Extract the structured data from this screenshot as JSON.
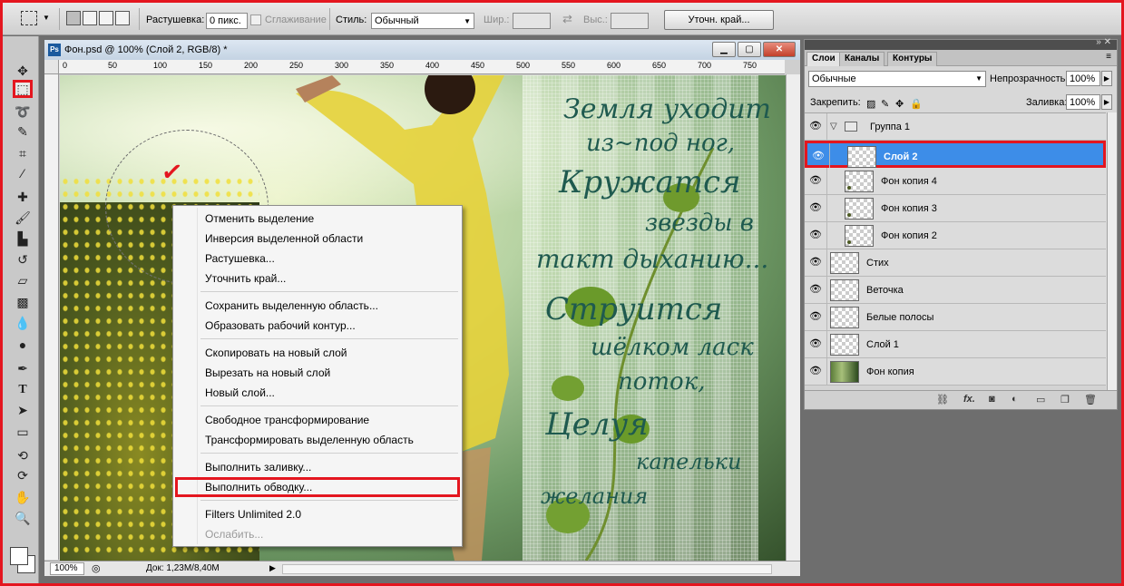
{
  "options_bar": {
    "feather_label": "Растушевка:",
    "feather_value": "0 пикс.",
    "antialias_label": "Сглаживание",
    "style_label": "Стиль:",
    "style_value": "Обычный",
    "width_label": "Шир.:",
    "height_label": "Выс.:",
    "refine_edge_button": "Уточн. край..."
  },
  "document": {
    "title": "Фон.psd @ 100% (Слой 2, RGB/8) *",
    "ruler_ticks": [
      "0",
      "50",
      "100",
      "150",
      "200",
      "250",
      "300",
      "350",
      "400",
      "450",
      "500",
      "550",
      "600",
      "650",
      "700",
      "750"
    ],
    "zoom": "100%",
    "doc_info": "Док: 1,23M/8,40M",
    "poem_lines": [
      "Земля уходит",
      "из~под ног,",
      "Кружатся",
      "звезды в",
      "такт дыханию...",
      "Струится",
      "шёлком ласк",
      "поток,",
      "Целуя",
      "капельки",
      "желания"
    ]
  },
  "context_menu": {
    "items": [
      {
        "label": "Отменить выделение",
        "disabled": false
      },
      {
        "label": "Инверсия выделенной области",
        "disabled": false
      },
      {
        "label": "Растушевка...",
        "disabled": false
      },
      {
        "label": "Уточнить край...",
        "disabled": false
      },
      {
        "label": "Сохранить выделенную область...",
        "disabled": false
      },
      {
        "label": "Образовать рабочий контур...",
        "disabled": false
      },
      {
        "label": "Скопировать на новый слой",
        "disabled": false
      },
      {
        "label": "Вырезать на новый слой",
        "disabled": false
      },
      {
        "label": "Новый слой...",
        "disabled": false
      },
      {
        "label": "Свободное трансформирование",
        "disabled": false
      },
      {
        "label": "Трансформировать выделенную область",
        "disabled": false
      },
      {
        "label": "Выполнить заливку...",
        "disabled": false
      },
      {
        "label": "Выполнить обводку...",
        "disabled": false,
        "highlighted": true
      },
      {
        "label": "Filters Unlimited 2.0",
        "disabled": false
      },
      {
        "label": "Ослабить...",
        "disabled": true
      }
    ]
  },
  "layers_panel": {
    "tabs": [
      "Слои",
      "Каналы",
      "Контуры"
    ],
    "blend_mode": "Обычные",
    "opacity_label": "Непрозрачность:",
    "opacity_value": "100%",
    "lock_label": "Закрепить:",
    "fill_label": "Заливка:",
    "fill_value": "100%",
    "layers": [
      {
        "name": "Группа 1",
        "type": "group"
      },
      {
        "name": "Слой 2",
        "selected": true
      },
      {
        "name": "Фон копия 4"
      },
      {
        "name": "Фон копия 3"
      },
      {
        "name": "Фон копия 2"
      },
      {
        "name": "Стих"
      },
      {
        "name": "Веточка"
      },
      {
        "name": "Белые полосы"
      },
      {
        "name": "Слой 1"
      },
      {
        "name": "Фон копия"
      }
    ],
    "footer_icons": [
      "link-icon",
      "fx-icon",
      "mask-icon",
      "adjustment-icon",
      "folder-icon",
      "new-layer-icon",
      "trash-icon"
    ]
  },
  "colors": {
    "highlight_red": "#e4161f",
    "selection_blue": "#3d8de8"
  }
}
